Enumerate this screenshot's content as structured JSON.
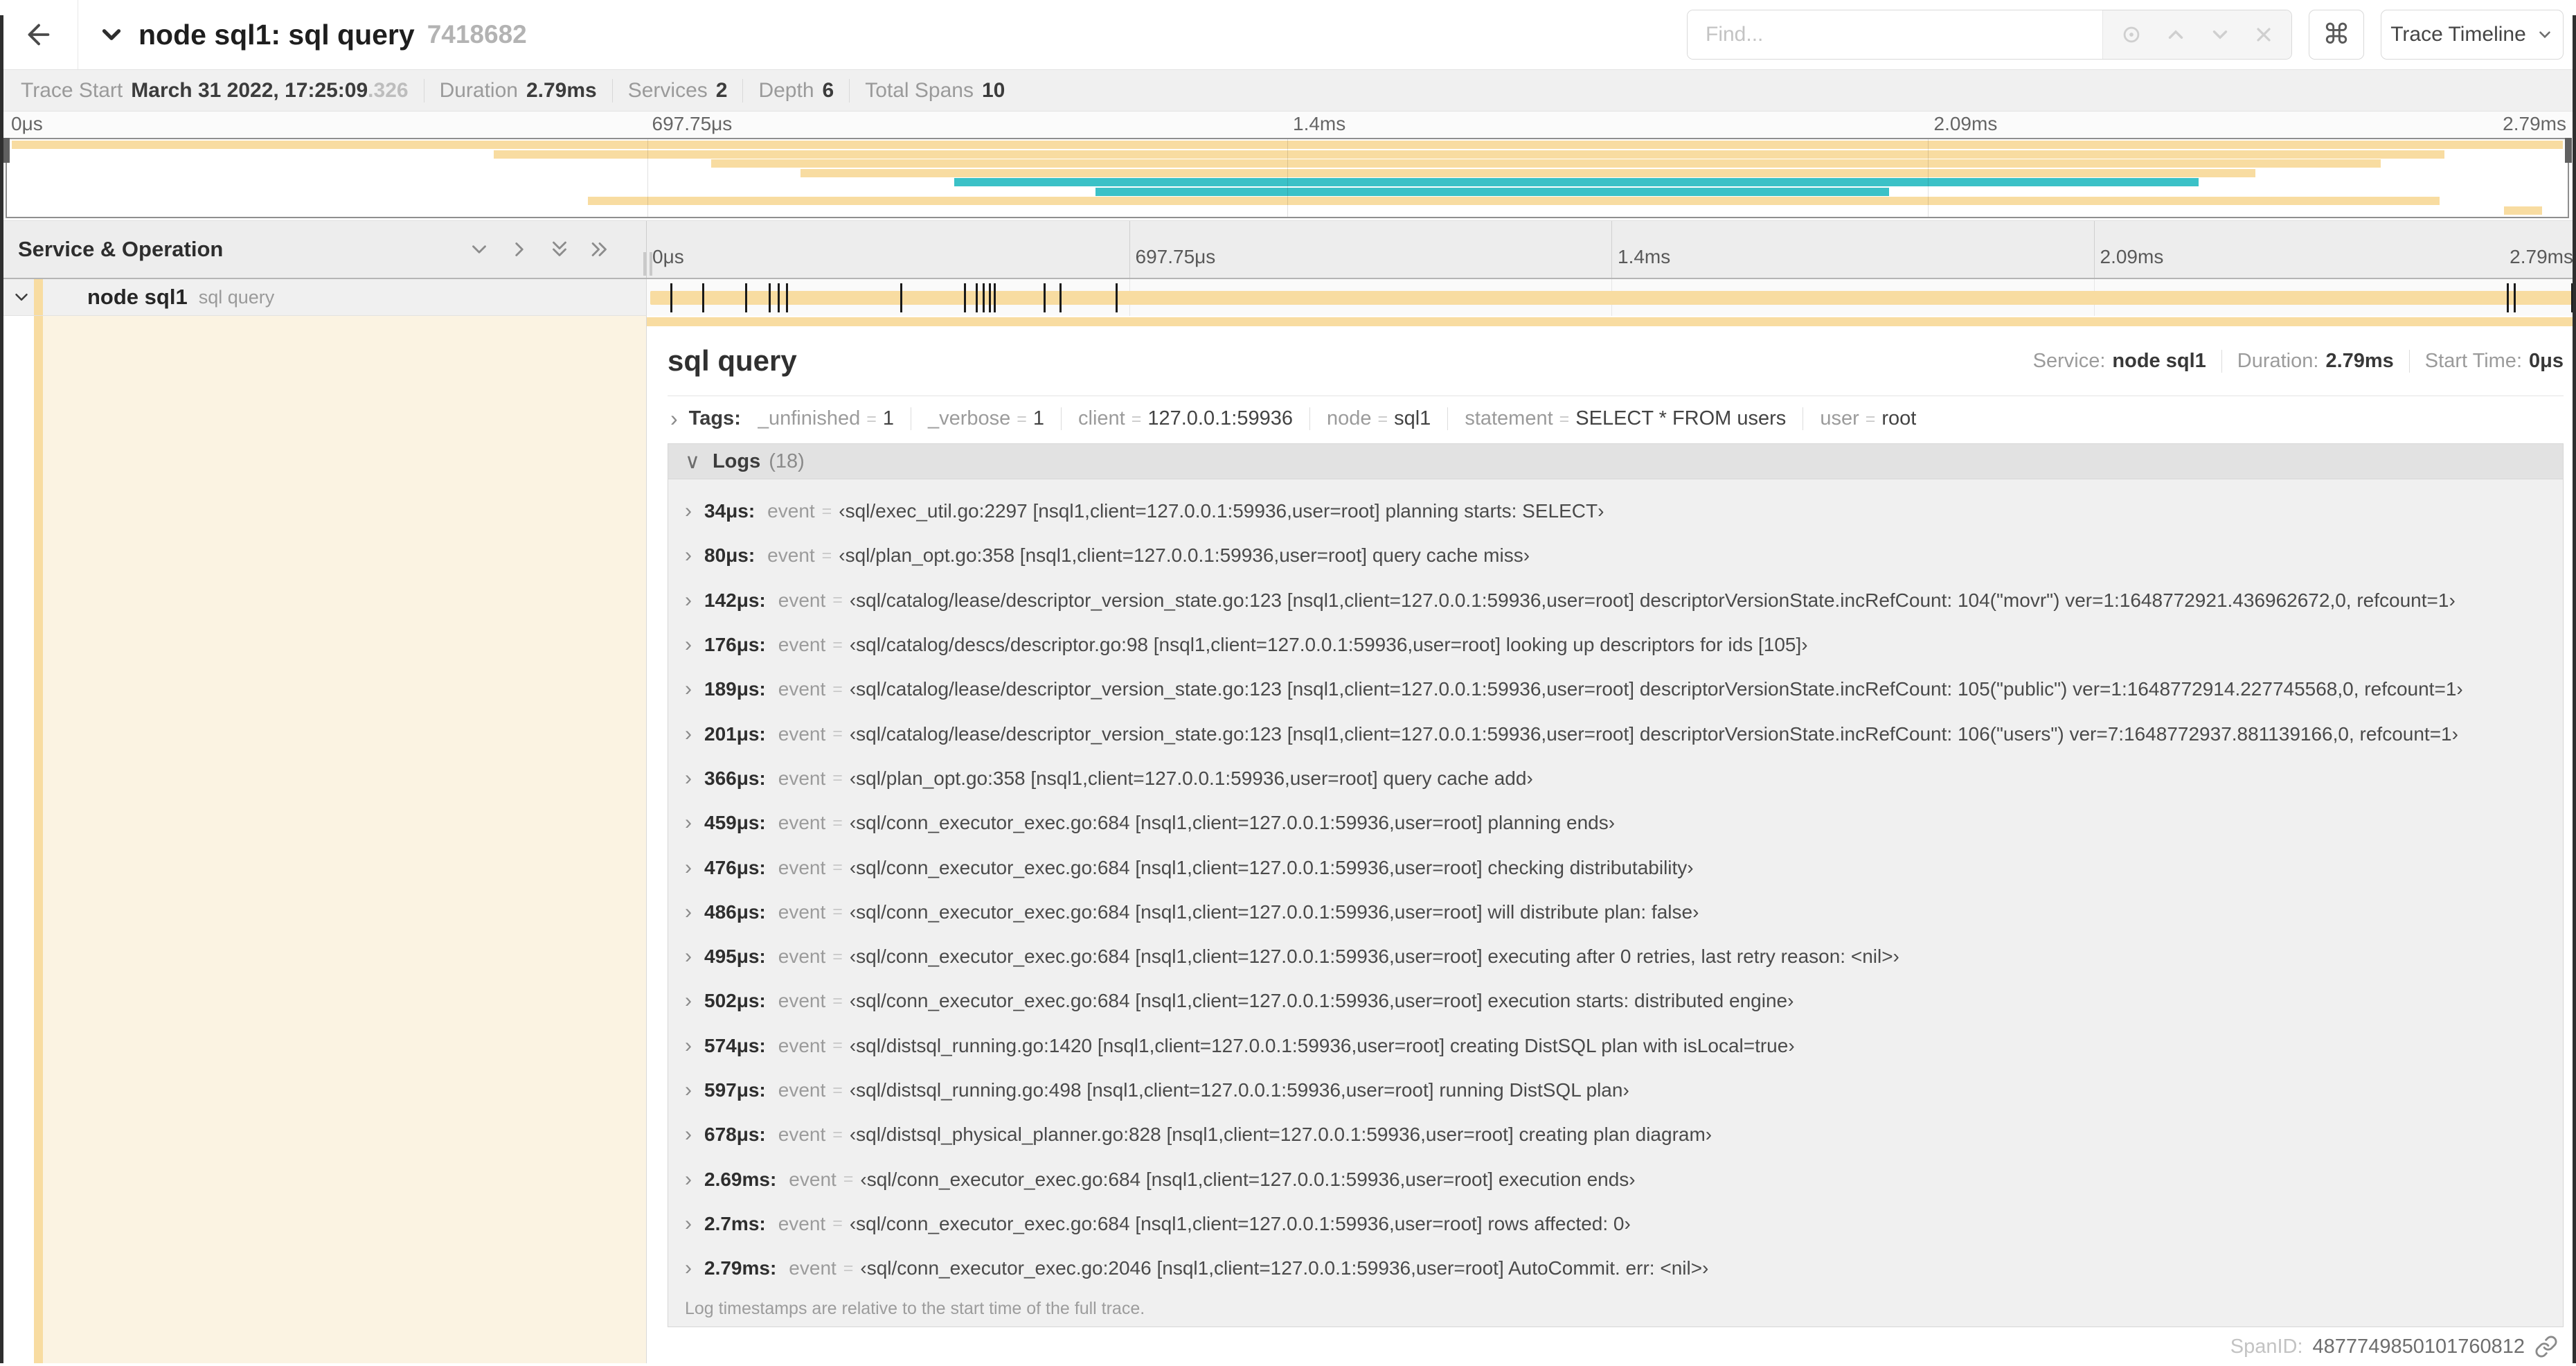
{
  "header": {
    "title": "node sql1: sql query",
    "trace_id": "7418682",
    "find_placeholder": "Find...",
    "shortcut_icon": "⌘",
    "view_select": "Trace Timeline"
  },
  "subnav": {
    "items": [
      {
        "label": "Trace Start",
        "value": "March 31 2022, 17:25:09",
        "suffix": ".326"
      },
      {
        "label": "Duration",
        "value": "2.79ms"
      },
      {
        "label": "Services",
        "value": "2"
      },
      {
        "label": "Depth",
        "value": "6"
      },
      {
        "label": "Total Spans",
        "value": "10"
      }
    ]
  },
  "timeline": {
    "left_header": "Service & Operation",
    "axis_ticks": [
      {
        "label": "0μs",
        "pos": 0
      },
      {
        "label": "697.75μs",
        "pos": 0.25
      },
      {
        "label": "1.4ms",
        "pos": 0.5
      },
      {
        "label": "2.09ms",
        "pos": 0.75
      },
      {
        "label": "2.79ms",
        "pos": 1
      }
    ]
  },
  "colors": {
    "tan": "#f8dca1",
    "teal": "#3bc1c7",
    "detail_tint": "#fbf3e2"
  },
  "minimap": {
    "bars": [
      {
        "row": 0,
        "color": "tan",
        "start": 0.002,
        "end": 0.998
      },
      {
        "row": 1,
        "color": "tan",
        "start": 0.19,
        "end": 0.952
      },
      {
        "row": 2,
        "color": "tan",
        "start": 0.275,
        "end": 0.927
      },
      {
        "row": 3,
        "color": "tan",
        "start": 0.31,
        "end": 0.878
      },
      {
        "row": 4,
        "color": "teal",
        "start": 0.37,
        "end": 0.856
      },
      {
        "row": 5,
        "color": "teal",
        "start": 0.425,
        "end": 0.735
      },
      {
        "row": 6,
        "color": "tan",
        "start": 0.227,
        "end": 0.95
      },
      {
        "row": 7,
        "color": "tan",
        "start": 0.975,
        "end": 0.99
      }
    ]
  },
  "span_row": {
    "service": "node sql1",
    "operation": "sql query",
    "log_tick_fractions": [
      0.0122,
      0.0287,
      0.0509,
      0.0631,
      0.0677,
      0.072,
      0.1312,
      0.1645,
      0.1706,
      0.1742,
      0.1774,
      0.1799,
      0.2057,
      0.214,
      0.243,
      0.9642,
      0.9677,
      1.0
    ]
  },
  "detail": {
    "operation": "sql query",
    "service_label": "Service:",
    "service": "node sql1",
    "duration_label": "Duration:",
    "duration": "2.79ms",
    "start_label": "Start Time:",
    "start": "0μs",
    "tags_label": "Tags:",
    "tags": [
      {
        "key": "_unfinished",
        "value": "1"
      },
      {
        "key": "_verbose",
        "value": "1"
      },
      {
        "key": "client",
        "value": "127.0.0.1:59936"
      },
      {
        "key": "node",
        "value": "sql1"
      },
      {
        "key": "statement",
        "value": "SELECT * FROM users"
      },
      {
        "key": "user",
        "value": "root"
      }
    ],
    "logs_label": "Logs",
    "logs_count": "(18)",
    "logs": [
      {
        "time": "34μs",
        "key": "event",
        "value": "‹sql/exec_util.go:2297 [nsql1,client=127.0.0.1:59936,user=root] planning starts: SELECT›"
      },
      {
        "time": "80μs",
        "key": "event",
        "value": "‹sql/plan_opt.go:358 [nsql1,client=127.0.0.1:59936,user=root] query cache miss›"
      },
      {
        "time": "142μs",
        "key": "event",
        "value": "‹sql/catalog/lease/descriptor_version_state.go:123 [nsql1,client=127.0.0.1:59936,user=root] descriptorVersionState.incRefCount: 104(\"movr\") ver=1:1648772921.436962672,0, refcount=1›"
      },
      {
        "time": "176μs",
        "key": "event",
        "value": "‹sql/catalog/descs/descriptor.go:98 [nsql1,client=127.0.0.1:59936,user=root] looking up descriptors for ids [105]›"
      },
      {
        "time": "189μs",
        "key": "event",
        "value": "‹sql/catalog/lease/descriptor_version_state.go:123 [nsql1,client=127.0.0.1:59936,user=root] descriptorVersionState.incRefCount: 105(\"public\") ver=1:1648772914.227745568,0, refcount=1›"
      },
      {
        "time": "201μs",
        "key": "event",
        "value": "‹sql/catalog/lease/descriptor_version_state.go:123 [nsql1,client=127.0.0.1:59936,user=root] descriptorVersionState.incRefCount: 106(\"users\") ver=7:1648772937.881139166,0, refcount=1›"
      },
      {
        "time": "366μs",
        "key": "event",
        "value": "‹sql/plan_opt.go:358 [nsql1,client=127.0.0.1:59936,user=root] query cache add›"
      },
      {
        "time": "459μs",
        "key": "event",
        "value": "‹sql/conn_executor_exec.go:684 [nsql1,client=127.0.0.1:59936,user=root] planning ends›"
      },
      {
        "time": "476μs",
        "key": "event",
        "value": "‹sql/conn_executor_exec.go:684 [nsql1,client=127.0.0.1:59936,user=root] checking distributability›"
      },
      {
        "time": "486μs",
        "key": "event",
        "value": "‹sql/conn_executor_exec.go:684 [nsql1,client=127.0.0.1:59936,user=root] will distribute plan: false›"
      },
      {
        "time": "495μs",
        "key": "event",
        "value": "‹sql/conn_executor_exec.go:684 [nsql1,client=127.0.0.1:59936,user=root] executing after 0 retries, last retry reason: <nil>›"
      },
      {
        "time": "502μs",
        "key": "event",
        "value": "‹sql/conn_executor_exec.go:684 [nsql1,client=127.0.0.1:59936,user=root] execution starts: distributed engine›"
      },
      {
        "time": "574μs",
        "key": "event",
        "value": "‹sql/distsql_running.go:1420 [nsql1,client=127.0.0.1:59936,user=root] creating DistSQL plan with isLocal=true›"
      },
      {
        "time": "597μs",
        "key": "event",
        "value": "‹sql/distsql_running.go:498 [nsql1,client=127.0.0.1:59936,user=root] running DistSQL plan›"
      },
      {
        "time": "678μs",
        "key": "event",
        "value": "‹sql/distsql_physical_planner.go:828 [nsql1,client=127.0.0.1:59936,user=root] creating plan diagram›"
      },
      {
        "time": "2.69ms",
        "key": "event",
        "value": "‹sql/conn_executor_exec.go:684 [nsql1,client=127.0.0.1:59936,user=root] execution ends›"
      },
      {
        "time": "2.7ms",
        "key": "event",
        "value": "‹sql/conn_executor_exec.go:684 [nsql1,client=127.0.0.1:59936,user=root] rows affected: 0›"
      },
      {
        "time": "2.79ms",
        "key": "event",
        "value": "‹sql/conn_executor_exec.go:2046 [nsql1,client=127.0.0.1:59936,user=root] AutoCommit. err: <nil>›"
      }
    ],
    "note": "Log timestamps are relative to the start time of the full trace.",
    "span_id_label": "SpanID:",
    "span_id": "4877749850101760812"
  },
  "icons": [
    "back-arrow-icon",
    "chevron-down-icon",
    "target-icon",
    "chevron-up-icon",
    "close-icon",
    "command-key-icon",
    "collapse-one-icon",
    "expand-one-icon",
    "collapse-all-icon",
    "expand-all-icon",
    "link-icon"
  ]
}
